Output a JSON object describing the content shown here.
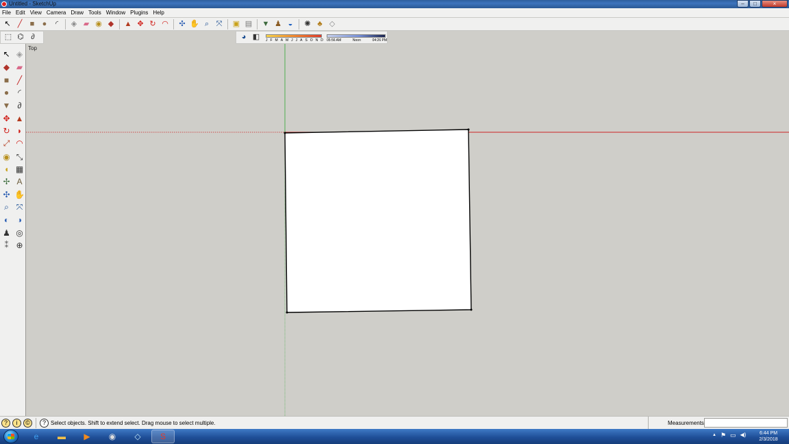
{
  "window": {
    "title": "Untitled - SketchUp",
    "min": "–",
    "max": "□",
    "close": "×"
  },
  "menu": [
    "File",
    "Edit",
    "View",
    "Camera",
    "Draw",
    "Tools",
    "Window",
    "Plugins",
    "Help"
  ],
  "toolbar_main": [
    {
      "name": "select-tool-icon",
      "glyph": "↖",
      "color": "#000000"
    },
    {
      "name": "line-tool-icon",
      "glyph": "╱",
      "color": "#c02020"
    },
    {
      "name": "rectangle-tool-icon",
      "glyph": "■",
      "color": "#8a6d4a"
    },
    {
      "name": "circle-tool-icon",
      "glyph": "●",
      "color": "#8a6d4a"
    },
    {
      "name": "arc-tool-icon",
      "glyph": "◜",
      "color": "#333333"
    },
    {
      "name": "sep"
    },
    {
      "name": "make-component-icon",
      "glyph": "◈",
      "color": "#888888"
    },
    {
      "name": "eraser-tool-icon",
      "glyph": "▰",
      "color": "#d96a8a"
    },
    {
      "name": "tape-measure-icon",
      "glyph": "◉",
      "color": "#b8901e"
    },
    {
      "name": "paint-bucket-icon",
      "glyph": "◆",
      "color": "#b0342b"
    },
    {
      "name": "sep"
    },
    {
      "name": "push-pull-icon",
      "glyph": "▲",
      "color": "#b33a1e"
    },
    {
      "name": "move-tool-icon",
      "glyph": "✥",
      "color": "#d0201a"
    },
    {
      "name": "rotate-tool-icon",
      "glyph": "↻",
      "color": "#d0201a"
    },
    {
      "name": "offset-tool-icon",
      "glyph": "◠",
      "color": "#d0201a"
    },
    {
      "name": "sep"
    },
    {
      "name": "orbit-tool-icon",
      "glyph": "✣",
      "color": "#2c5fb3"
    },
    {
      "name": "pan-tool-icon",
      "glyph": "✋",
      "color": "#444444"
    },
    {
      "name": "zoom-tool-icon",
      "glyph": "⌕",
      "color": "#1a4d91"
    },
    {
      "name": "zoom-extents-icon",
      "glyph": "⤧",
      "color": "#1a4d91"
    },
    {
      "name": "sep"
    },
    {
      "name": "warehouse-icon",
      "glyph": "▣",
      "color": "#c9a21a"
    },
    {
      "name": "share-model-icon",
      "glyph": "▤",
      "color": "#7a7a7a"
    },
    {
      "name": "sep"
    },
    {
      "name": "get-models-icon",
      "glyph": "▼",
      "color": "#3d6a3d"
    },
    {
      "name": "position-camera-icon",
      "glyph": "♟",
      "color": "#8a5b22"
    },
    {
      "name": "sandbox-icon",
      "glyph": "◒",
      "color": "#2061c0"
    },
    {
      "name": "sep"
    },
    {
      "name": "extension-icon",
      "glyph": "✺",
      "color": "#333333"
    },
    {
      "name": "ruby-icon",
      "glyph": "♣",
      "color": "#b07a14"
    },
    {
      "name": "styles-icon",
      "glyph": "◇",
      "color": "#888888"
    }
  ],
  "toolbar_views": [
    {
      "name": "iso-view-icon",
      "glyph": "⬚",
      "color": "#333333"
    },
    {
      "name": "select-lasso-icon",
      "glyph": "⌬",
      "color": "#333333"
    },
    {
      "name": "freehand-icon",
      "glyph": "∂",
      "color": "#333333"
    }
  ],
  "shadows": {
    "months": [
      "J",
      "F",
      "M",
      "A",
      "M",
      "J",
      "J",
      "A",
      "S",
      "O",
      "N",
      "D"
    ],
    "start_time": "05:56 AM",
    "mid_time": "Noon",
    "end_time": "04:26 PM"
  },
  "palette": [
    {
      "name": "select-tool-icon",
      "glyph": "↖",
      "color": "#000000"
    },
    {
      "name": "make-component-icon",
      "glyph": "◈",
      "color": "#9a9a9a"
    },
    {
      "name": "paint-bucket-icon",
      "glyph": "◆",
      "color": "#b0342b"
    },
    {
      "name": "eraser-tool-icon",
      "glyph": "▰",
      "color": "#d96a8a"
    },
    {
      "name": "rectangle-tool-icon",
      "glyph": "■",
      "color": "#8a6d4a"
    },
    {
      "name": "line-tool-icon",
      "glyph": "╱",
      "color": "#c02020"
    },
    {
      "name": "circle-tool-icon",
      "glyph": "●",
      "color": "#8a6d4a"
    },
    {
      "name": "arc-tool-icon",
      "glyph": "◜",
      "color": "#333333"
    },
    {
      "name": "polygon-tool-icon",
      "glyph": "▼",
      "color": "#8a6d4a"
    },
    {
      "name": "freehand-tool-icon",
      "glyph": "∂",
      "color": "#333333"
    },
    {
      "name": "move-tool-icon",
      "glyph": "✥",
      "color": "#d0201a"
    },
    {
      "name": "push-pull-icon",
      "glyph": "▲",
      "color": "#b33a1e"
    },
    {
      "name": "rotate-tool-icon",
      "glyph": "↻",
      "color": "#d0201a"
    },
    {
      "name": "follow-me-icon",
      "glyph": "◗",
      "color": "#d0201a"
    },
    {
      "name": "scale-tool-icon",
      "glyph": "⤢",
      "color": "#b33a1e"
    },
    {
      "name": "offset-tool-icon",
      "glyph": "◠",
      "color": "#d0201a"
    },
    {
      "name": "tape-measure-icon",
      "glyph": "◉",
      "color": "#b8901e"
    },
    {
      "name": "dimension-tool-icon",
      "glyph": "⤡",
      "color": "#333333"
    },
    {
      "name": "protractor-icon",
      "glyph": "◖",
      "color": "#c9a21a"
    },
    {
      "name": "text-tool-icon",
      "glyph": "▦",
      "color": "#333333"
    },
    {
      "name": "axes-tool-icon",
      "glyph": "✢",
      "color": "#3a6a3a"
    },
    {
      "name": "3d-text-icon",
      "glyph": "A",
      "color": "#6a5a3a"
    },
    {
      "name": "orbit-tool-icon",
      "glyph": "✣",
      "color": "#2c5fb3"
    },
    {
      "name": "pan-tool-icon",
      "glyph": "✋",
      "color": "#444444"
    },
    {
      "name": "zoom-tool-icon",
      "glyph": "⌕",
      "color": "#1a4d91"
    },
    {
      "name": "zoom-window-icon",
      "glyph": "⤧",
      "color": "#1a4d91"
    },
    {
      "name": "previous-view-icon",
      "glyph": "◐",
      "color": "#2c5fb3"
    },
    {
      "name": "next-view-icon",
      "glyph": "◑",
      "color": "#2c5fb3"
    },
    {
      "name": "position-camera-icon",
      "glyph": "♟",
      "color": "#333333"
    },
    {
      "name": "look-around-icon",
      "glyph": "◎",
      "color": "#333333"
    },
    {
      "name": "walk-tool-icon",
      "glyph": "⁑",
      "color": "#555555"
    },
    {
      "name": "section-plane-icon",
      "glyph": "⊕",
      "color": "#333333"
    }
  ],
  "viewport": {
    "view_label": "Top",
    "background": "#cfcec9",
    "red_axis_color": "#cc2222",
    "green_axis_color": "#4caf50",
    "face_fill": "#ffffff",
    "edge_color": "#000000"
  },
  "status": {
    "icon_a": "?",
    "icon_b": "i",
    "icon_c": "©",
    "help": "?",
    "text": "Select objects. Shift to extend select. Drag mouse to select multiple.",
    "measurements_label": "Measurements",
    "measurements_value": ""
  },
  "taskbar": {
    "apps": [
      {
        "name": "internet-explorer-icon",
        "glyph": "e",
        "color": "#3fa0f0"
      },
      {
        "name": "file-explorer-icon",
        "glyph": "▬",
        "color": "#f3c14a"
      },
      {
        "name": "media-player-icon",
        "glyph": "▶",
        "color": "#f08a1e"
      },
      {
        "name": "camera-app-icon",
        "glyph": "◉",
        "color": "#dddddd"
      },
      {
        "name": "notepad-app-icon",
        "glyph": "◇",
        "color": "#bfe3f5"
      },
      {
        "name": "sketchup-app-icon",
        "glyph": "S",
        "color": "#e53a2a"
      }
    ],
    "tray_caret": "▲",
    "tray_flag": "⚑",
    "tray_network": "▭",
    "tray_volume": "◀)",
    "time": "6:44 PM",
    "date": "2/3/2018"
  }
}
